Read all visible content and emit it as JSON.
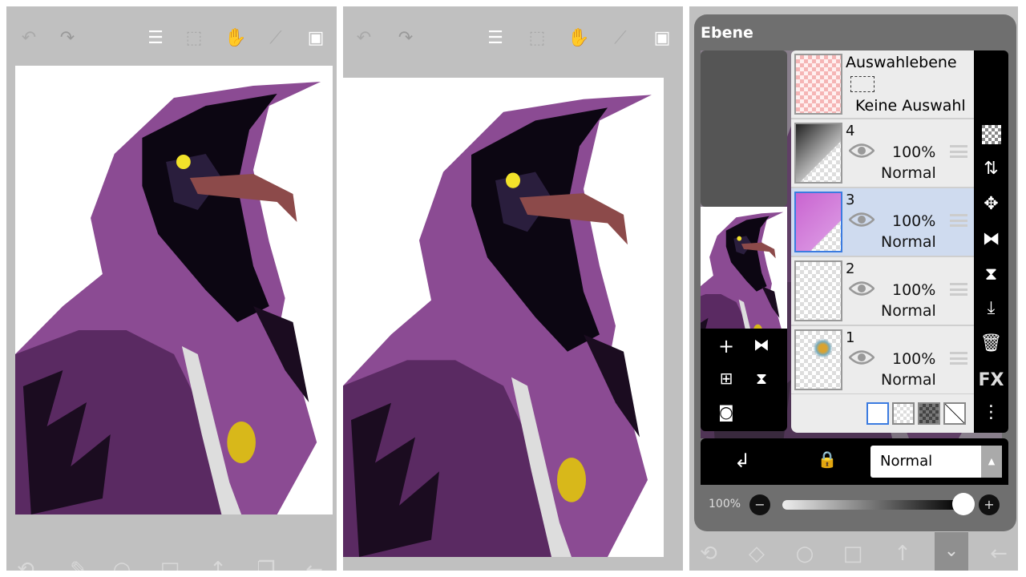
{
  "toolbar_icons": [
    "undo-icon",
    "redo-icon",
    "toggle-settings-icon",
    "selection-icon",
    "hand-tool-icon",
    "ruler-icon",
    "image-icon"
  ],
  "bottom_icons": [
    "transform-icon",
    "eraser-icon",
    "circle-icon",
    "square-icon",
    "arrow-up-icon",
    "collapse-icon",
    "back-arrow-icon"
  ],
  "layers_panel": {
    "title": "Ebene",
    "selection_layer": {
      "name": "Auswahlebene",
      "status": "Keine Auswahl"
    },
    "layers": [
      {
        "number": "4",
        "opacity": "100%",
        "blend": "Normal",
        "selected": false
      },
      {
        "number": "3",
        "opacity": "100%",
        "blend": "Normal",
        "selected": true
      },
      {
        "number": "2",
        "opacity": "100%",
        "blend": "Normal",
        "selected": false
      },
      {
        "number": "1",
        "opacity": "100%",
        "blend": "Normal",
        "selected": false
      }
    ],
    "blend_mode_select": "Normal",
    "opacity_label": "100%",
    "opacity_value": 100,
    "right_tools": [
      "checker-icon",
      "swap-layers-icon",
      "move-icon",
      "flip-horizontal-icon",
      "flip-vertical-icon",
      "merge-down-icon",
      "trash-icon",
      "FX",
      "more-icon"
    ],
    "fx_label": "FX"
  },
  "colors": {
    "panel_bg": "#c0c0c0",
    "dialog_bg": "#6f6f6f",
    "selected_row": "#cfdbef",
    "hood_purple": "#8a4a92",
    "accent_blue": "#3b7be0"
  }
}
